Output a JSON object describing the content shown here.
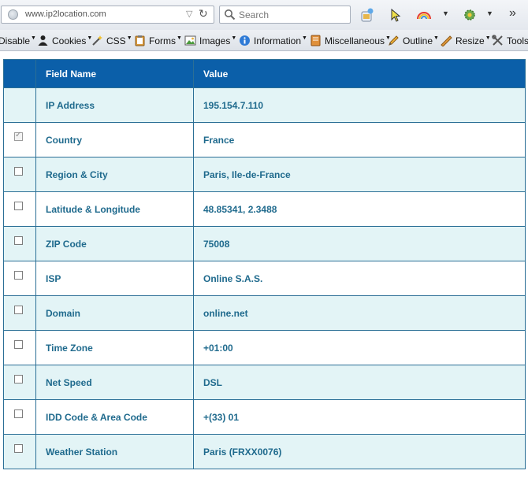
{
  "navbar": {
    "url": "www.ip2location.com",
    "search_placeholder": "Search",
    "overflow": "»"
  },
  "devbar": {
    "items": [
      {
        "label": "Disable"
      },
      {
        "label": "Cookies"
      },
      {
        "label": "CSS"
      },
      {
        "label": "Forms"
      },
      {
        "label": "Images"
      },
      {
        "label": "Information"
      },
      {
        "label": "Miscellaneous"
      },
      {
        "label": "Outline"
      },
      {
        "label": "Resize"
      },
      {
        "label": "Tools"
      }
    ]
  },
  "table": {
    "headers": {
      "checkbox": "",
      "field": "Field Name",
      "value": "Value"
    },
    "rows": [
      {
        "field": "IP Address",
        "value": "195.154.7.110",
        "checkbox": "none"
      },
      {
        "field": "Country",
        "value": "France",
        "checkbox": "checked"
      },
      {
        "field": "Region & City",
        "value": "Paris, Ile-de-France",
        "checkbox": "unchecked"
      },
      {
        "field": "Latitude & Longitude",
        "value": "48.85341, 2.3488",
        "checkbox": "unchecked"
      },
      {
        "field": "ZIP Code",
        "value": "75008",
        "checkbox": "unchecked"
      },
      {
        "field": "ISP",
        "value": "Online S.A.S.",
        "checkbox": "unchecked"
      },
      {
        "field": "Domain",
        "value": "online.net",
        "checkbox": "unchecked"
      },
      {
        "field": "Time Zone",
        "value": "+01:00",
        "checkbox": "unchecked"
      },
      {
        "field": "Net Speed",
        "value": "DSL",
        "checkbox": "unchecked"
      },
      {
        "field": "IDD Code & Area Code",
        "value": "+(33) 01",
        "checkbox": "unchecked"
      },
      {
        "field": "Weather Station",
        "value": "Paris (FRXX0076)",
        "checkbox": "unchecked"
      }
    ]
  },
  "colors": {
    "header_bg": "#0b5fa9",
    "row_alt_bg": "#e3f4f6",
    "text": "#1f6a8d",
    "border": "#2b6f96"
  }
}
